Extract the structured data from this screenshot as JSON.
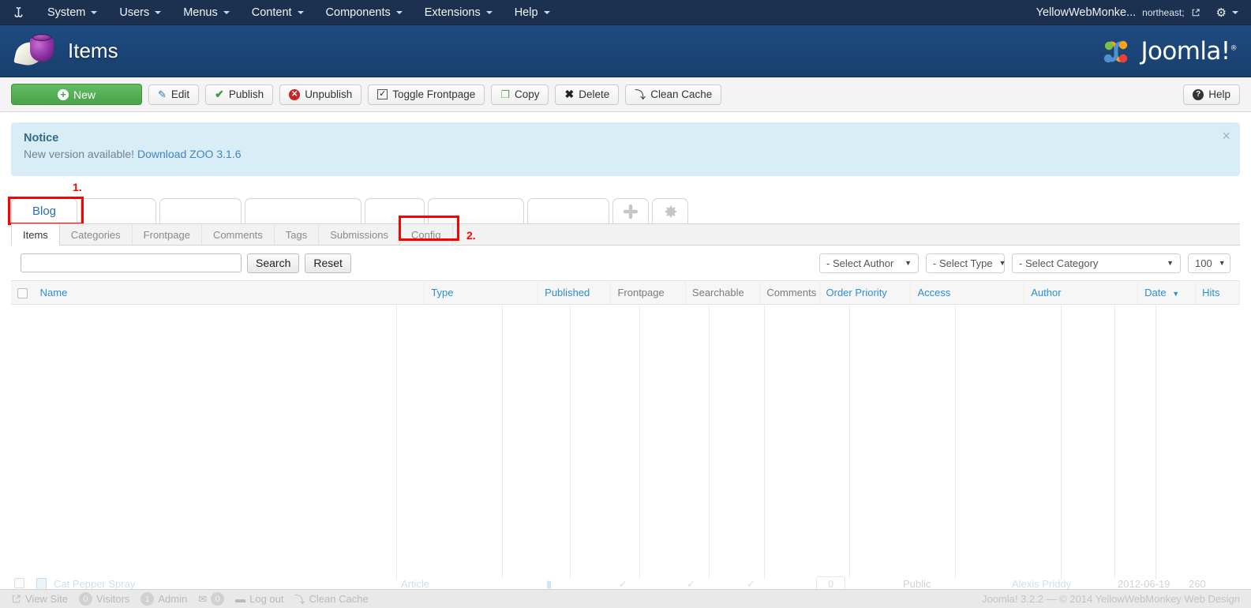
{
  "topbar": {
    "brand_icon": "joomla-mark-icon",
    "menu": [
      {
        "label": "System",
        "caret": true
      },
      {
        "label": "Users",
        "caret": true
      },
      {
        "label": "Menus",
        "caret": true
      },
      {
        "label": "Content",
        "caret": true
      },
      {
        "label": "Components",
        "caret": true
      },
      {
        "label": "Extensions",
        "caret": true
      },
      {
        "label": "Help",
        "caret": true
      }
    ],
    "user_label": "YellowWebMonke...",
    "external_icon": "external-link-icon",
    "gear_icon": "gear-icon"
  },
  "header": {
    "title": "Items",
    "page_icon": "inkwell-quill-icon",
    "brand_text": "Joomla!",
    "brand_sup": "®"
  },
  "toolbar": {
    "new_label": "New",
    "edit_label": "Edit",
    "publish_label": "Publish",
    "unpublish_label": "Unpublish",
    "toggle_frontpage_label": "Toggle Frontpage",
    "copy_label": "Copy",
    "delete_label": "Delete",
    "clean_cache_label": "Clean Cache",
    "help_label": "Help"
  },
  "notice": {
    "title": "Notice",
    "message": "New version available!",
    "link_text": "Download ZOO 3.1.6",
    "close_glyph": "×"
  },
  "app_tabs": {
    "tabs": [
      {
        "label": "Blog",
        "active": true
      },
      {
        "label": "",
        "active": false
      },
      {
        "label": "",
        "active": false
      },
      {
        "label": "",
        "active": false
      },
      {
        "label": "",
        "active": false
      },
      {
        "label": "",
        "active": false
      },
      {
        "label": "",
        "active": false
      }
    ],
    "add_glyph": "+",
    "settings_glyph": "gear"
  },
  "sub_tabs": [
    {
      "label": "Items",
      "active": true
    },
    {
      "label": "Categories",
      "active": false
    },
    {
      "label": "Frontpage",
      "active": false
    },
    {
      "label": "Comments",
      "active": false
    },
    {
      "label": "Tags",
      "active": false
    },
    {
      "label": "Submissions",
      "active": false
    },
    {
      "label": "Config",
      "active": false
    }
  ],
  "annotations": [
    {
      "label": "1.",
      "target": "blog-tab"
    },
    {
      "label": "2.",
      "target": "config-subtab"
    }
  ],
  "filters": {
    "search_value": "",
    "search_placeholder": "",
    "search_button": "Search",
    "reset_button": "Reset",
    "author_select": "- Select Author",
    "type_select": "- Select Type",
    "category_select": "- Select Category",
    "limit_select": "100",
    "arrow_glyph": "▼"
  },
  "table": {
    "columns": [
      {
        "label": "Name",
        "link": true
      },
      {
        "label": "Type",
        "link": true
      },
      {
        "label": "Published",
        "link": true
      },
      {
        "label": "Frontpage",
        "link": true
      },
      {
        "label": "Searchable",
        "link": false
      },
      {
        "label": "Comments",
        "link": false
      },
      {
        "label": "Order Priority",
        "link": true
      },
      {
        "label": "Access",
        "link": true
      },
      {
        "label": "Author",
        "link": true
      },
      {
        "label": "Date",
        "link": true,
        "sorted": true
      },
      {
        "label": "Hits",
        "link": true
      }
    ],
    "sort_glyph": "▼",
    "partial_row": {
      "name": "Cat Pepper Spray",
      "type": "Article",
      "order_priority": "0",
      "access": "Public",
      "author": "Alexis Priddy",
      "date": "2012-06-19",
      "hits": "260"
    }
  },
  "statusbar": {
    "view_site": "View Site",
    "visitors_count": "0",
    "visitors_label": "Visitors",
    "admin_count": "1",
    "admin_label": "Admin",
    "messages_count": "0",
    "logout_label": "Log out",
    "clean_cache_label": "Clean Cache",
    "copyright": "Joomla! 3.2.2  —  © 2014 YellowWebMonkey Web Design"
  },
  "colors": {
    "topbar_bg": "#1c3050",
    "header_bg": "#1b4577",
    "accent_link": "#2a8fd4",
    "new_button": "#4aa24a",
    "notice_bg": "#d9edf7",
    "annotation_red": "#ff0000"
  }
}
